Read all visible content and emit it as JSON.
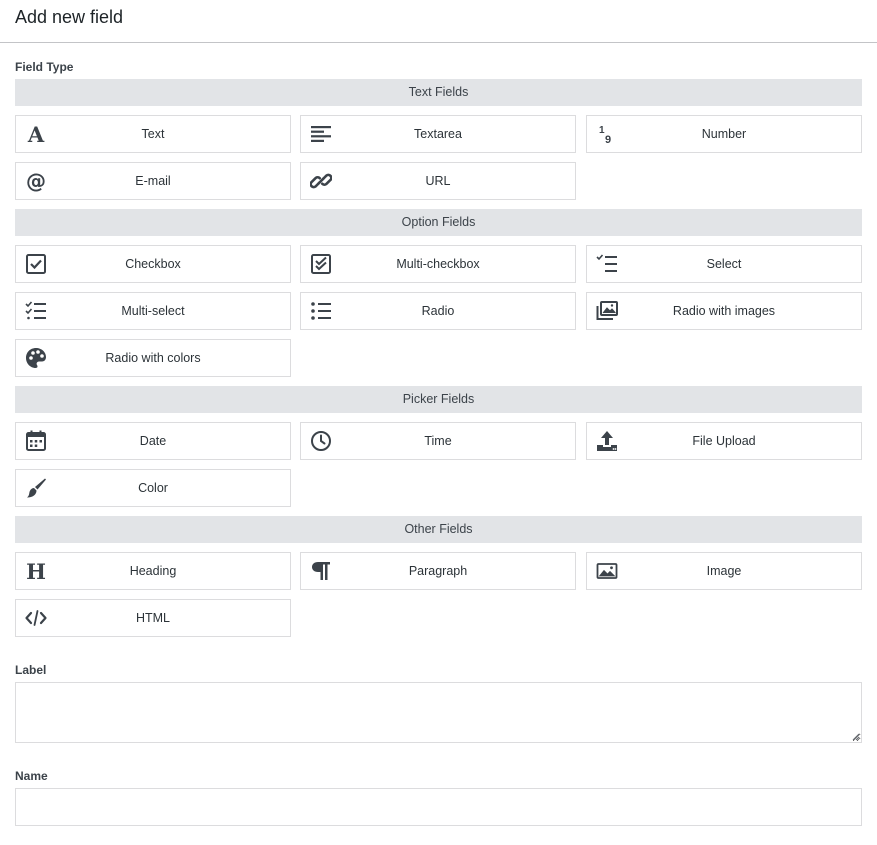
{
  "header": {
    "title": "Add new field"
  },
  "field_type": {
    "label": "Field Type",
    "groups": [
      {
        "title": "Text Fields",
        "items": [
          {
            "label": "Text",
            "icon": "text-icon"
          },
          {
            "label": "Textarea",
            "icon": "textarea-icon"
          },
          {
            "label": "Number",
            "icon": "number-icon"
          },
          {
            "label": "E-mail",
            "icon": "email-icon"
          },
          {
            "label": "URL",
            "icon": "link-icon"
          }
        ]
      },
      {
        "title": "Option Fields",
        "items": [
          {
            "label": "Checkbox",
            "icon": "checkbox-icon"
          },
          {
            "label": "Multi-checkbox",
            "icon": "multi-checkbox-icon"
          },
          {
            "label": "Select",
            "icon": "select-icon"
          },
          {
            "label": "Multi-select",
            "icon": "multi-select-icon"
          },
          {
            "label": "Radio",
            "icon": "radio-list-icon"
          },
          {
            "label": "Radio with images",
            "icon": "images-icon"
          },
          {
            "label": "Radio with colors",
            "icon": "palette-icon"
          }
        ]
      },
      {
        "title": "Picker Fields",
        "items": [
          {
            "label": "Date",
            "icon": "calendar-icon"
          },
          {
            "label": "Time",
            "icon": "clock-icon"
          },
          {
            "label": "File Upload",
            "icon": "upload-icon"
          },
          {
            "label": "Color",
            "icon": "brush-icon"
          }
        ]
      },
      {
        "title": "Other Fields",
        "items": [
          {
            "label": "Heading",
            "icon": "heading-icon"
          },
          {
            "label": "Paragraph",
            "icon": "paragraph-icon"
          },
          {
            "label": "Image",
            "icon": "image-icon"
          },
          {
            "label": "HTML",
            "icon": "code-icon"
          }
        ]
      }
    ]
  },
  "label_field": {
    "label": "Label",
    "value": ""
  },
  "name_field": {
    "label": "Name",
    "value": ""
  },
  "colors": {
    "group_bar": "#e2e4e7",
    "border": "#dcdcde",
    "icon": "#3c434a"
  }
}
